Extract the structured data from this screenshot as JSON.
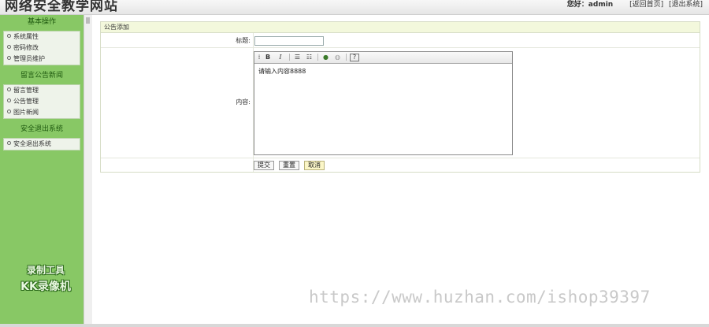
{
  "header": {
    "site_title": "网络安全教学网站",
    "user_label": "您好：admin",
    "links": [
      "[返回首页]",
      "[退出系统]"
    ]
  },
  "sidebar": {
    "groups": [
      {
        "title": "基本操作",
        "items": [
          "系统属性",
          "密码修改",
          "管理员维护"
        ]
      },
      {
        "title": "留言公告新闻",
        "items": [
          "留言管理",
          "公告管理",
          "图片新闻"
        ]
      },
      {
        "title": "安全退出系统",
        "items": [
          "安全退出系统"
        ]
      }
    ]
  },
  "form": {
    "caption": "公告添加",
    "title_label": "标题:",
    "title_value": "",
    "content_label": "内容:",
    "content_value": "请输入内容8888",
    "toolbar": {
      "bold": "B",
      "italic": "I"
    },
    "buttons": {
      "submit": "提交",
      "reset": "重置",
      "cancel": "取消"
    }
  },
  "watermarks": {
    "tool_line1": "录制工具",
    "tool_line2": "KK录像机",
    "url": "https://www.huzhan.com/ishop39397"
  }
}
